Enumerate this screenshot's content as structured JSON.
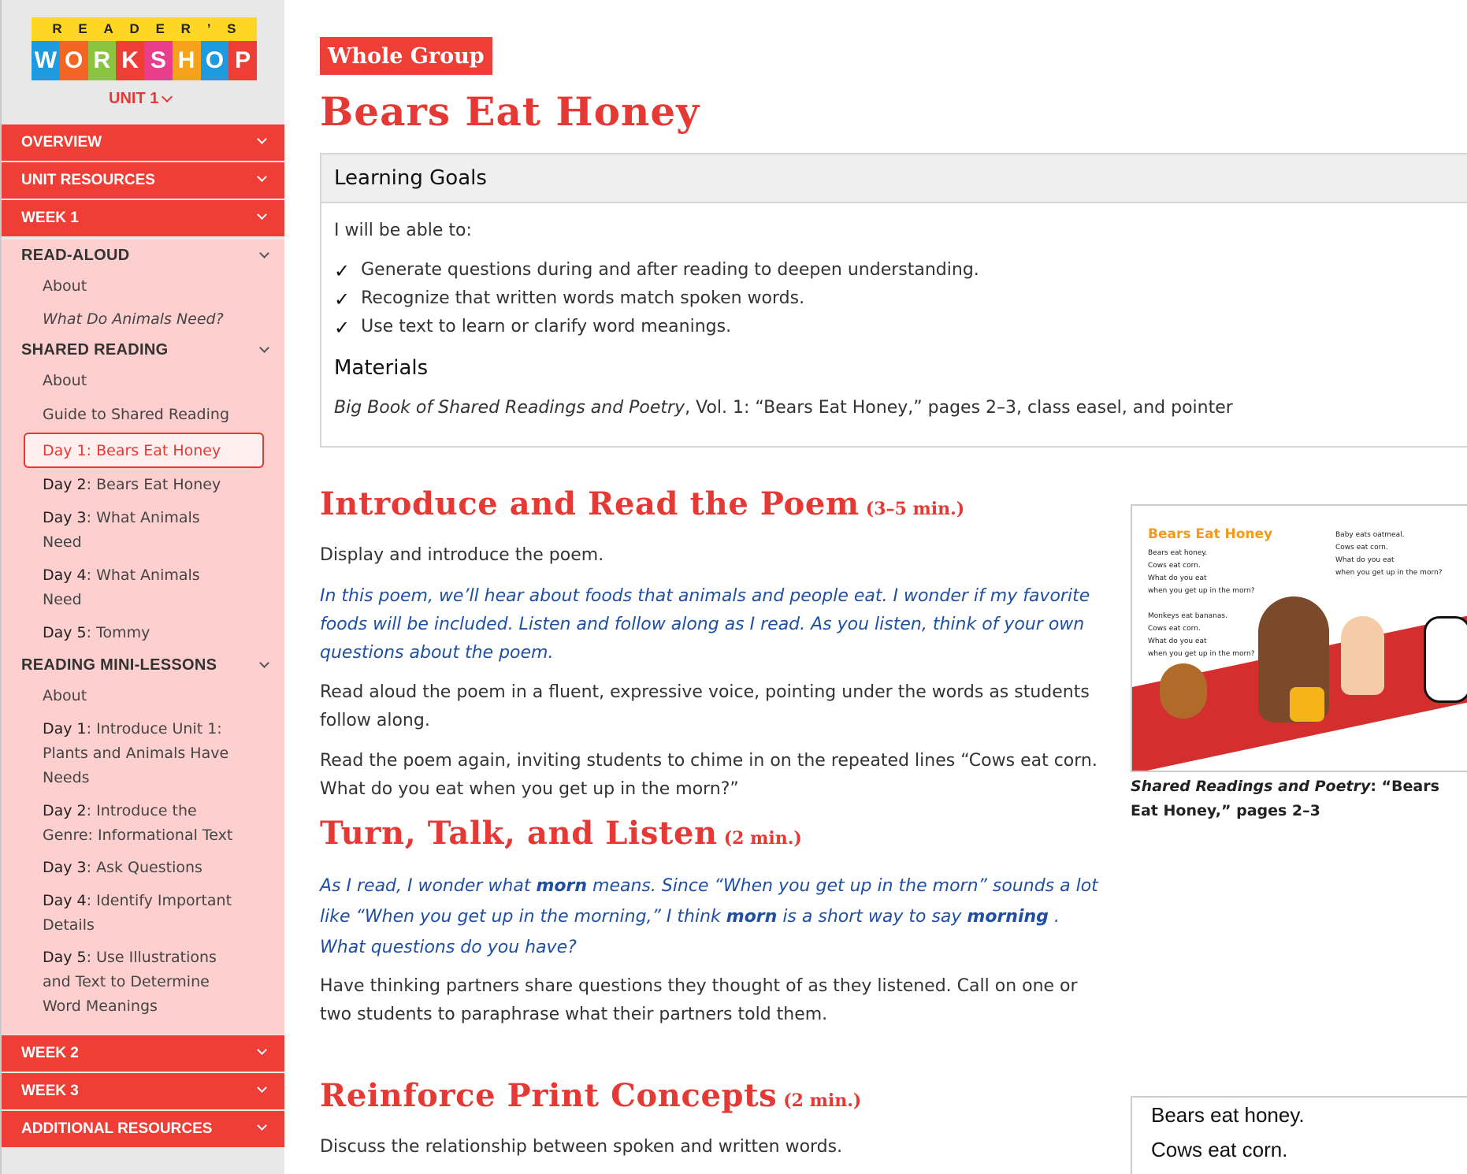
{
  "sidebar": {
    "logo": {
      "top": [
        "R",
        "E",
        "A",
        "D",
        "E",
        "R",
        "’",
        "S"
      ],
      "tiles": [
        {
          "char": "W",
          "color": "#1e9be0"
        },
        {
          "char": "O",
          "color": "#f26522"
        },
        {
          "char": "R",
          "color": "#8bc53f"
        },
        {
          "char": "K",
          "color": "#ef3e36"
        },
        {
          "char": "S",
          "color": "#e83e8c"
        },
        {
          "char": "H",
          "color": "#f7a21b"
        },
        {
          "char": "O",
          "color": "#1e9be0"
        },
        {
          "char": "P",
          "color": "#ef3e36"
        }
      ]
    },
    "unit_label": "UNIT 1",
    "top_nav": [
      "OVERVIEW",
      "UNIT RESOURCES",
      "WEEK 1"
    ],
    "sections": {
      "read_aloud": {
        "label": "READ-ALOUD",
        "items": [
          "About",
          "What Do Animals Need?"
        ]
      },
      "shared_reading": {
        "label": "SHARED READING",
        "items": [
          "About",
          "Guide to Shared Reading"
        ],
        "active": {
          "day": "Day 1",
          "title": ": Bears Eat Honey"
        },
        "days": [
          {
            "day": "Day 2",
            "title": ": Bears Eat Honey"
          },
          {
            "day": "Day 3",
            "title": ": What Animals",
            "title2": "Need"
          },
          {
            "day": "Day 4",
            "title": ": What Animals",
            "title2": "Need"
          },
          {
            "day": "Day 5",
            "title": ": Tommy"
          }
        ]
      },
      "mini_lessons": {
        "label": "READING MINI-LESSONS",
        "about": "About",
        "days": [
          {
            "day": "Day 1",
            "lines": [
              ": Introduce Unit 1:",
              "Plants and Animals Have",
              "Needs"
            ]
          },
          {
            "day": "Day 2",
            "lines": [
              ": Introduce the",
              "Genre: Informational Text"
            ]
          },
          {
            "day": "Day 3",
            "lines": [
              ": Ask Questions"
            ]
          },
          {
            "day": "Day 4",
            "lines": [
              ": Identify Important",
              "Details"
            ]
          },
          {
            "day": "Day 5",
            "lines": [
              ": Use Illustrations",
              "and Text to Determine",
              "Word Meanings"
            ]
          }
        ]
      }
    },
    "bottom_nav": [
      "WEEK 2",
      "WEEK 3",
      "ADDITIONAL RESOURCES"
    ]
  },
  "main": {
    "badge": "Whole Group",
    "title": "Bears Eat Honey",
    "goals": {
      "heading": "Learning Goals",
      "intro": "I will be able to:",
      "items": [
        "Generate questions during and after reading to deepen understanding.",
        "Recognize that written words match spoken words.",
        "Use text to learn or clarify word meanings."
      ],
      "check": "✓",
      "materials_heading": "Materials",
      "materials_italic": "Big Book of Shared Readings and Poetry",
      "materials_rest": ", Vol. 1: “Bears Eat Honey,” pages 2–3, class easel, and pointer"
    },
    "intro_section": {
      "heading": "Introduce and Read the Poem",
      "time": "(3–5 min.)",
      "p1": "Display and introduce the poem.",
      "teacher": "In this poem, we’ll hear about foods that animals and people eat. I wonder if my favorite foods will be included. Listen and follow along as I read. As you listen, think of your own questions about the poem.",
      "p2": "Read aloud the poem in a fluent, expressive voice, pointing under the words as students follow along.",
      "p3": "Read the poem again, inviting students to chime in on the repeated lines “Cows eat corn. What do you eat when you get up in the morn?”"
    },
    "turn_section": {
      "heading": "Turn, Talk, and Listen",
      "time": "(2 min.)",
      "t1": "As I read, I wonder what ",
      "t1b": "morn",
      "t2": " means. Since “When you get up in the morn” sounds a lot like “When you get up in the morning,” I think ",
      "t2b": "morn",
      "t3": " is a short way to say ",
      "t3b": "morning",
      "t4": " . What questions do you have?",
      "p1": "Have thinking partners share questions they thought of as they listened. Call on one or two students to paraphrase what their partners told them."
    },
    "reinforce_section": {
      "heading": "Reinforce Print Concepts",
      "time": "(2 min.)",
      "p1": "Discuss the relationship between spoken and written words."
    },
    "poem_image": {
      "title": "Bears Eat Honey",
      "left_lines": [
        "Bears eat honey.",
        "Cows eat corn.",
        "What do you eat",
        "when you get up in the morn?",
        "",
        "Monkeys eat bananas.",
        "Cows eat corn.",
        "What do you eat",
        "when you get up in the morn?"
      ],
      "right_lines": [
        "Baby eats oatmeal.",
        "Cows eat corn.",
        "What do you eat",
        "when you get up in the morn?"
      ],
      "caption_italic": "Shared Readings and Poetry",
      "caption_rest": ": “Bears Eat Honey,” pages 2–3"
    },
    "print_box": [
      "Bears eat honey.",
      "Cows eat corn."
    ]
  }
}
